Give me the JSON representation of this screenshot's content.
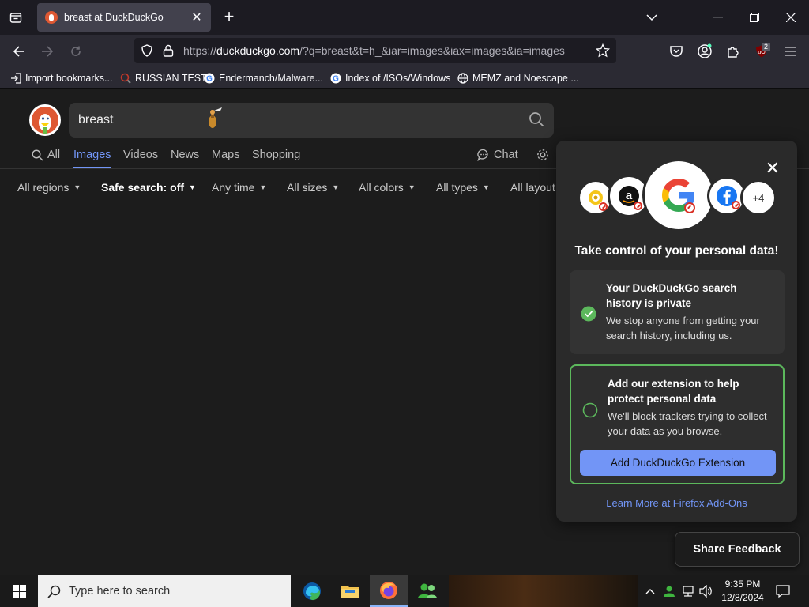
{
  "browser": {
    "tab": {
      "title": "breast at DuckDuckGo"
    },
    "url": {
      "prefix": "https://",
      "host": "duckduckgo.com",
      "path": "/?q=breast&t=h_&iar=images&iax=images&ia=images"
    },
    "extension_badge": "2",
    "bookmarks": [
      {
        "label": "Import bookmarks...",
        "icon": "import-icon"
      },
      {
        "label": "RUSSIAN TEST",
        "icon": "magnifier-favicon"
      },
      {
        "label": "Endermanch/Malware...",
        "icon": "google-favicon"
      },
      {
        "label": "Index of /ISOs/Windows",
        "icon": "google-favicon"
      },
      {
        "label": "MEMZ and Noescape ...",
        "icon": "globe-icon"
      }
    ]
  },
  "search": {
    "query": "breast"
  },
  "search_tabs": [
    {
      "label": "All",
      "icon": "search-icon"
    },
    {
      "label": "Images",
      "active": true
    },
    {
      "label": "Videos"
    },
    {
      "label": "News"
    },
    {
      "label": "Maps"
    },
    {
      "label": "Shopping"
    }
  ],
  "chat_label": "Chat",
  "filters": [
    {
      "label": "All regions"
    },
    {
      "label": "Safe search: off",
      "highlight": true
    },
    {
      "label": "Any time"
    },
    {
      "label": "All sizes"
    },
    {
      "label": "All colors"
    },
    {
      "label": "All types"
    },
    {
      "label": "All layout"
    }
  ],
  "popup": {
    "plus_count": "+4",
    "title": "Take control of your personal data!",
    "card1": {
      "title": "Your DuckDuckGo search history is private",
      "desc": "We stop anyone from getting your search history, including us."
    },
    "card2": {
      "title": "Add our extension to help protect personal data",
      "desc": "We'll block trackers trying to collect your data as you browse.",
      "button": "Add DuckDuckGo Extension"
    },
    "learn_more": "Learn More at Firefox Add-Ons"
  },
  "feedback_label": "Share Feedback",
  "taskbar": {
    "search_placeholder": "Type here to search",
    "time": "9:35 PM",
    "date": "12/8/2024"
  },
  "colors": {
    "accent": "#7295f6",
    "ddg_orange": "#de5833",
    "success": "#5cb85c"
  }
}
